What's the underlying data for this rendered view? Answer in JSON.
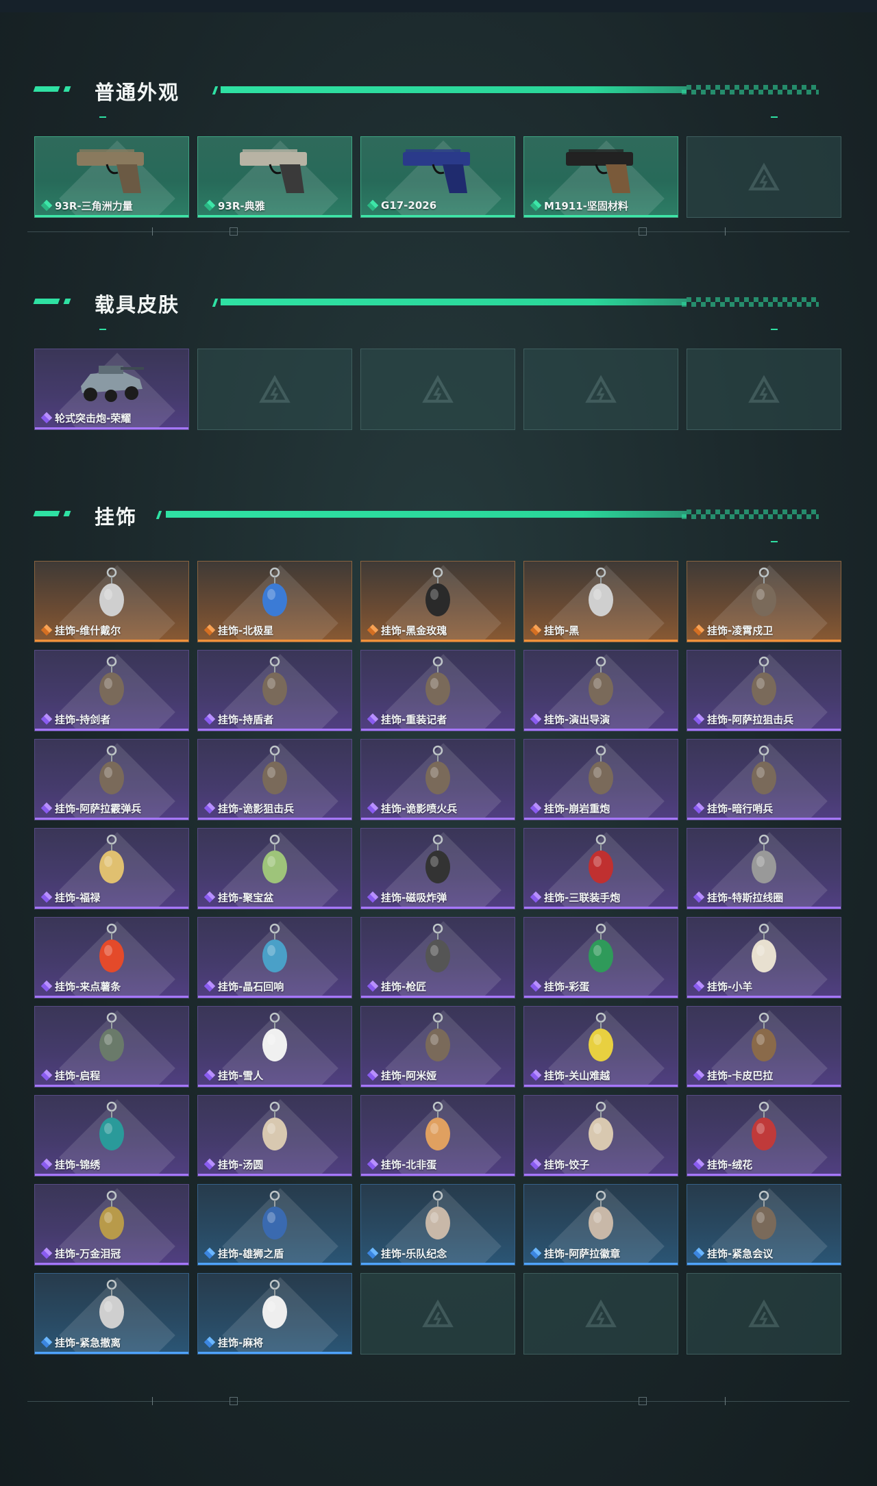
{
  "sections": [
    {
      "title": "普通外观",
      "items": [
        {
          "label": "93R-三角洲力量",
          "rarity": "green",
          "icon": "pistol-tan-icon"
        },
        {
          "label": "93R-典雅",
          "rarity": "green",
          "icon": "pistol-silver-icon"
        },
        {
          "label": "G17-2026",
          "rarity": "green",
          "icon": "pistol-blue-icon"
        },
        {
          "label": "M1911-坚固材料",
          "rarity": "green",
          "icon": "pistol-black-icon"
        },
        {
          "label": "",
          "rarity": "empty",
          "icon": "placeholder-logo-icon"
        }
      ]
    },
    {
      "title": "载具皮肤",
      "items": [
        {
          "label": "轮式突击炮-荣耀",
          "rarity": "purple",
          "icon": "vehicle-icon"
        },
        {
          "label": "",
          "rarity": "empty",
          "icon": "placeholder-logo-icon"
        },
        {
          "label": "",
          "rarity": "empty",
          "icon": "placeholder-logo-icon"
        },
        {
          "label": "",
          "rarity": "empty",
          "icon": "placeholder-logo-icon"
        },
        {
          "label": "",
          "rarity": "empty",
          "icon": "placeholder-logo-icon"
        }
      ]
    },
    {
      "title": "挂饰",
      "items": [
        {
          "label": "挂饰-维什戴尔",
          "rarity": "orange",
          "icon": "charm-tag-icon"
        },
        {
          "label": "挂饰-北极星",
          "rarity": "orange",
          "icon": "charm-star-icon"
        },
        {
          "label": "挂饰-黑金玫瑰",
          "rarity": "orange",
          "icon": "charm-rose-icon"
        },
        {
          "label": "挂饰-黑",
          "rarity": "orange",
          "icon": "charm-tag-icon"
        },
        {
          "label": "挂饰-凌霄戍卫",
          "rarity": "orange",
          "icon": "charm-figure-icon"
        },
        {
          "label": "挂饰-持剑者",
          "rarity": "purple",
          "icon": "charm-figure-icon"
        },
        {
          "label": "挂饰-持盾者",
          "rarity": "purple",
          "icon": "charm-figure-icon"
        },
        {
          "label": "挂饰-重装记者",
          "rarity": "purple",
          "icon": "charm-figure-icon"
        },
        {
          "label": "挂饰-演出导演",
          "rarity": "purple",
          "icon": "charm-figure-icon"
        },
        {
          "label": "挂饰-阿萨拉狙击兵",
          "rarity": "purple",
          "icon": "charm-figure-icon"
        },
        {
          "label": "挂饰-阿萨拉霰弹兵",
          "rarity": "purple",
          "icon": "charm-figure-icon"
        },
        {
          "label": "挂饰-诡影狙击兵",
          "rarity": "purple",
          "icon": "charm-figure-icon"
        },
        {
          "label": "挂饰-诡影喷火兵",
          "rarity": "purple",
          "icon": "charm-figure-icon"
        },
        {
          "label": "挂饰-崩岩重炮",
          "rarity": "purple",
          "icon": "charm-figure-icon"
        },
        {
          "label": "挂饰-暗行哨兵",
          "rarity": "purple",
          "icon": "charm-figure-icon"
        },
        {
          "label": "挂饰-福禄",
          "rarity": "purple",
          "icon": "charm-gourd-icon"
        },
        {
          "label": "挂饰-聚宝盆",
          "rarity": "purple",
          "icon": "charm-bowl-icon"
        },
        {
          "label": "挂饰-磁吸炸弹",
          "rarity": "purple",
          "icon": "charm-bomb-icon"
        },
        {
          "label": "挂饰-三联装手炮",
          "rarity": "purple",
          "icon": "charm-launcher-icon"
        },
        {
          "label": "挂饰-特斯拉线圈",
          "rarity": "purple",
          "icon": "charm-coil-icon"
        },
        {
          "label": "挂饰-来点薯条",
          "rarity": "purple",
          "icon": "charm-fries-icon"
        },
        {
          "label": "挂饰-晶石回响",
          "rarity": "purple",
          "icon": "charm-crystal-icon"
        },
        {
          "label": "挂饰-枪匠",
          "rarity": "purple",
          "icon": "charm-box-icon"
        },
        {
          "label": "挂饰-彩蛋",
          "rarity": "purple",
          "icon": "charm-egg-icon"
        },
        {
          "label": "挂饰-小羊",
          "rarity": "purple",
          "icon": "charm-sheep-icon"
        },
        {
          "label": "挂饰-启程",
          "rarity": "purple",
          "icon": "charm-ring-icon"
        },
        {
          "label": "挂饰-雪人",
          "rarity": "purple",
          "icon": "charm-snowman-icon"
        },
        {
          "label": "挂饰-阿米娅",
          "rarity": "purple",
          "icon": "charm-figure-icon"
        },
        {
          "label": "挂饰-关山难越",
          "rarity": "purple",
          "icon": "charm-scroll-icon"
        },
        {
          "label": "挂饰-卡皮巴拉",
          "rarity": "purple",
          "icon": "charm-capybara-icon"
        },
        {
          "label": "挂饰-锦绣",
          "rarity": "purple",
          "icon": "charm-butterfly-icon"
        },
        {
          "label": "挂饰-汤圆",
          "rarity": "purple",
          "icon": "charm-dumpling-icon"
        },
        {
          "label": "挂饰-北非蛋",
          "rarity": "purple",
          "icon": "charm-food-icon"
        },
        {
          "label": "挂饰-饺子",
          "rarity": "purple",
          "icon": "charm-dumpling-icon"
        },
        {
          "label": "挂饰-绒花",
          "rarity": "purple",
          "icon": "charm-flower-icon"
        },
        {
          "label": "挂饰-万金泪冠",
          "rarity": "purple",
          "icon": "charm-crown-icon"
        },
        {
          "label": "挂饰-雄狮之盾",
          "rarity": "blue",
          "icon": "charm-shield-icon"
        },
        {
          "label": "挂饰-乐队纪念",
          "rarity": "blue",
          "icon": "charm-badge-icon"
        },
        {
          "label": "挂饰-阿萨拉徽章",
          "rarity": "blue",
          "icon": "charm-badge-icon"
        },
        {
          "label": "挂饰-紧急会议",
          "rarity": "blue",
          "icon": "charm-figure-icon"
        },
        {
          "label": "挂饰-紧急撤离",
          "rarity": "blue",
          "icon": "charm-tag-icon"
        },
        {
          "label": "挂饰-麻将",
          "rarity": "blue",
          "icon": "charm-mahjong-icon"
        },
        {
          "label": "",
          "rarity": "empty",
          "icon": "placeholder-logo-icon"
        },
        {
          "label": "",
          "rarity": "empty",
          "icon": "placeholder-logo-icon"
        },
        {
          "label": "",
          "rarity": "empty",
          "icon": "placeholder-logo-icon"
        }
      ]
    }
  ],
  "colors": {
    "accent": "#2fe1a3",
    "green": "#3ee6a8",
    "purple": "#a677ff",
    "orange": "#f0913a",
    "blue": "#4fa3ff"
  }
}
